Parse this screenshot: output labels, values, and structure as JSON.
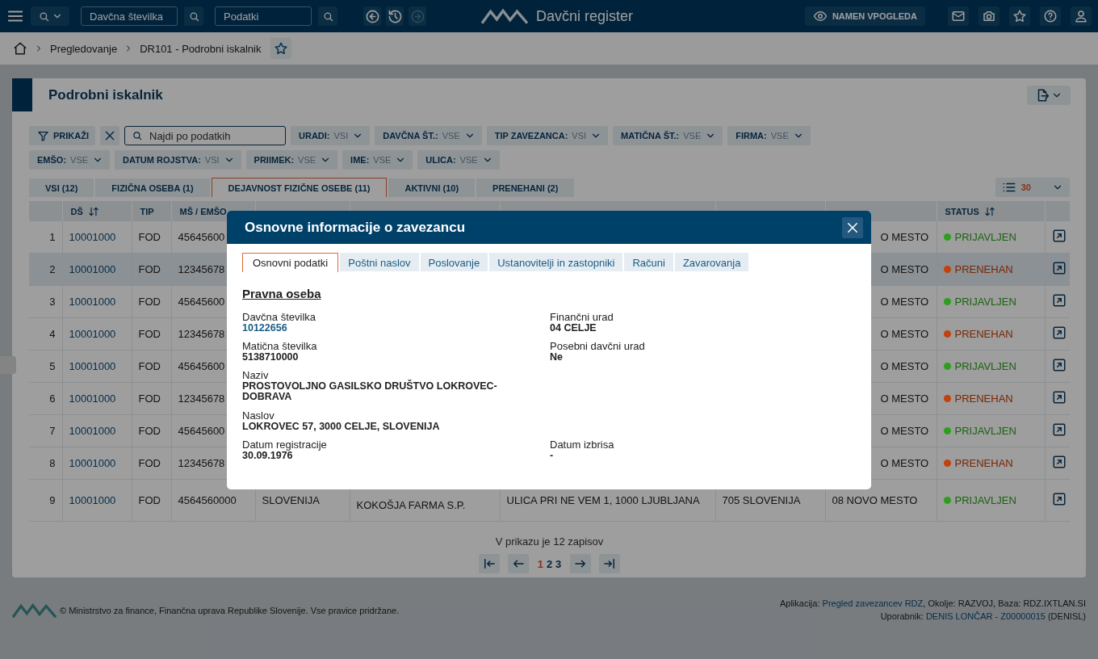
{
  "topbar": {
    "search_field": {
      "value": "Davčna številka"
    },
    "data_field": {
      "value": "Podatki"
    },
    "nav_buttons": [
      {
        "kind": "back",
        "disabled": false
      },
      {
        "kind": "history",
        "disabled": false
      },
      {
        "kind": "forward",
        "disabled": true
      }
    ],
    "app_title": "Davčni register",
    "purpose_button": "NAMEN VPOGLEDA"
  },
  "breadcrumb": [
    "Pregledovanje",
    "DR101 - Podrobni iskalnik"
  ],
  "page": {
    "title": "Podrobni iskalnik",
    "filters": {
      "show_button": "PRIKAŽI",
      "search": {
        "placeholder": "Najdi po podatkih"
      },
      "chips": [
        {
          "label": "URADI:",
          "value": "VSI"
        },
        {
          "label": "DAVČNA ŠT.:",
          "value": "VSE"
        },
        {
          "label": "TIP ZAVEZANCA:",
          "value": "VSI"
        },
        {
          "label": "MATIČNA ŠT.:",
          "value": "VSE"
        },
        {
          "label": "FIRMA:",
          "value": "VSE"
        },
        {
          "label": "EMŠO:",
          "value": "VSE"
        },
        {
          "label": "DATUM ROJSTVA:",
          "value": "VSI"
        },
        {
          "label": "PRIIMEK:",
          "value": "VSE"
        },
        {
          "label": "IME:",
          "value": "VSE"
        },
        {
          "label": "ULICA:",
          "value": "VSE"
        }
      ]
    },
    "tabs": [
      {
        "label": "VSI (12)",
        "selected": false
      },
      {
        "label": "FIZIČNA OSEBA (1)",
        "selected": false
      },
      {
        "label": "DEJAVNOST FIZIČNE OSEBE (11)",
        "selected": true
      },
      {
        "label": "AKTIVNI (10)",
        "selected": false
      },
      {
        "label": "PRENEHANI (2)",
        "selected": false
      }
    ],
    "page_size": "30",
    "table": {
      "columns": [
        {
          "label": "DŠ"
        },
        {
          "label": "TIP"
        },
        {
          "label": "MŠ / EMŠO"
        },
        {
          "label": "STATUS"
        }
      ],
      "rows": [
        {
          "kind": "covered",
          "number": "1",
          "ds": "10001000",
          "tip": "FOD",
          "ms_emso": "45645600",
          "kraj": "O MESTO",
          "status": {
            "text": "PRIJAVLJEN",
            "color": "#2ca01c"
          },
          "selected": false
        },
        {
          "kind": "covered",
          "number": "2",
          "ds": "10001000",
          "tip": "FOD",
          "ms_emso": "12345678",
          "kraj": "O MESTO",
          "status": {
            "text": "PRENEHAN",
            "color": "#c2410c"
          },
          "selected": true
        },
        {
          "kind": "covered",
          "number": "3",
          "ds": "10001000",
          "tip": "FOD",
          "ms_emso": "45645600",
          "kraj": "O MESTO",
          "status": {
            "text": "PRIJAVLJEN",
            "color": "#2ca01c"
          },
          "selected": false
        },
        {
          "kind": "covered",
          "number": "4",
          "ds": "10001000",
          "tip": "FOD",
          "ms_emso": "12345678",
          "kraj": "O MESTO",
          "status": {
            "text": "PRENEHAN",
            "color": "#c2410c"
          },
          "selected": false
        },
        {
          "kind": "covered",
          "number": "5",
          "ds": "10001000",
          "tip": "FOD",
          "ms_emso": "45645600",
          "kraj": "O MESTO",
          "status": {
            "text": "PRIJAVLJEN",
            "color": "#2ca01c"
          },
          "selected": false
        },
        {
          "kind": "covered",
          "number": "6",
          "ds": "10001000",
          "tip": "FOD",
          "ms_emso": "12345678",
          "kraj": "O MESTO",
          "status": {
            "text": "PRENEHAN",
            "color": "#c2410c"
          },
          "selected": false
        },
        {
          "kind": "covered",
          "number": "7",
          "ds": "10001000",
          "tip": "FOD",
          "ms_emso": "45645600",
          "kraj": "O MESTO",
          "status": {
            "text": "PRIJAVLJEN",
            "color": "#2ca01c"
          },
          "selected": false
        },
        {
          "kind": "covered",
          "number": "8",
          "ds": "10001000",
          "tip": "FOD",
          "ms_emso": "12345678",
          "kraj": "O MESTO",
          "status": {
            "text": "PRENEHAN",
            "color": "#c2410c"
          },
          "selected": false
        },
        {
          "kind": "full",
          "number": "9",
          "ds": "10001000",
          "tip": "FOD",
          "ms_emso": "4564560000",
          "drzava_rojstva": "SLOVENIJA",
          "naziv": "KOKOŠJA FARMA S.P.",
          "naslov": "ULICA PRI NE VEM 1, 1000 LJUBLJANA",
          "drzava": "705 SLOVENIJA",
          "kraj": "08 NOVO MESTO",
          "status": {
            "text": "PRIJAVLJEN",
            "color": "#2ca01c"
          },
          "selected": false
        }
      ]
    },
    "pagination": {
      "summary": "V prikazu je 12 zapisov",
      "pages": [
        {
          "label": "1",
          "selected": true
        },
        {
          "label": "2",
          "selected": false
        },
        {
          "label": "3",
          "selected": false
        }
      ]
    }
  },
  "footer": {
    "copyright": "© Ministrstvo za finance, Finančna uprava Republike Slovenije. Vse pravice pridržane.",
    "app_label": "Aplikacija:",
    "app_link": "Pregled zavezancev RDZ",
    "env": ", Okolje: RAZVOJ, Baza: RDZ.IXTLAN.SI",
    "user_label": "Uporabnik:",
    "user_link": " DENIS LONČAR - Z00000015",
    "user_code": "(DENISL)"
  },
  "modal": {
    "title": "Osnovne informacije o zavezancu",
    "tabs": [
      {
        "label": "Osnovni podatki",
        "selected": true
      },
      {
        "label": "Poštni naslov",
        "selected": false
      },
      {
        "label": "Poslovanje",
        "selected": false
      },
      {
        "label": "Ustanovitelji in zastopniki",
        "selected": false
      },
      {
        "label": "Računi",
        "selected": false
      },
      {
        "label": "Zavarovanja",
        "selected": false
      }
    ],
    "section_title": "Pravna oseba",
    "rows": [
      {
        "left": {
          "label": "Davčna številka",
          "value": "10122656",
          "kind": "link"
        },
        "right": {
          "label": "Finančni urad",
          "value": "04 CELJE",
          "kind": "text"
        }
      },
      {
        "left": {
          "label": "Matična številka",
          "value": "5138710000",
          "kind": "text"
        },
        "right": {
          "label": "Posebni davčni urad",
          "value": "Ne",
          "kind": "text"
        }
      },
      {
        "left": {
          "label": "Naziv",
          "value": "PROSTOVOLJNO GASILSKO DRUŠTVO LOKROVEC-DOBRAVA",
          "kind": "text"
        }
      },
      {
        "left": {
          "label": "Naslov",
          "value": "LOKROVEC 57, 3000 CELJE, SLOVENIJA",
          "kind": "text"
        }
      },
      {
        "left": {
          "label": "Datum registracije",
          "value": "30.09.1976",
          "kind": "text"
        },
        "right": {
          "label": "Datum izbrisa",
          "value": "-",
          "kind": "text"
        }
      }
    ]
  }
}
